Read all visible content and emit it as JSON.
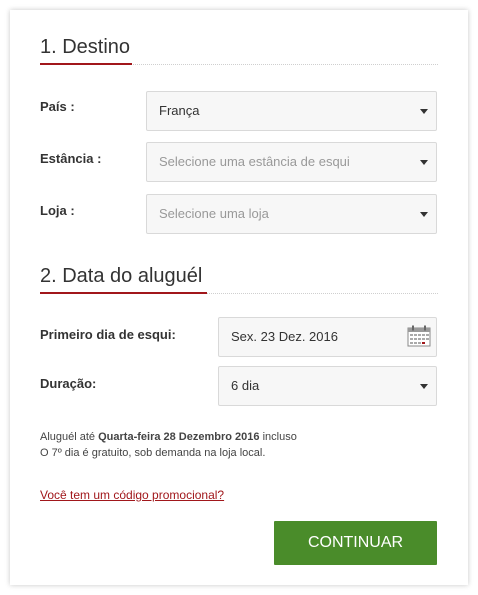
{
  "section1": {
    "title": "1. Destino"
  },
  "country": {
    "label": "País :",
    "value": "França"
  },
  "resort": {
    "label": "Estância :",
    "placeholder": "Selecione uma estância de esqui"
  },
  "shop": {
    "label": "Loja :",
    "placeholder": "Selecione uma loja"
  },
  "section2": {
    "title": "2. Data do aluguél"
  },
  "first_day": {
    "label": "Primeiro dia de esqui:",
    "value": "Sex. 23 Dez. 2016"
  },
  "duration": {
    "label": "Duração:",
    "value": "6 dia"
  },
  "info": {
    "prefix": "Aluguél até ",
    "date": "Quarta-feira 28 Dezembro 2016",
    "suffix": " incluso",
    "line2": "O 7º dia é gratuito, sob demanda na loja local."
  },
  "promo_link": "Você tem um código promocional?",
  "continue_button": "CONTINUAR",
  "colors": {
    "accent": "#a1171b",
    "button": "#4a8c2a"
  }
}
